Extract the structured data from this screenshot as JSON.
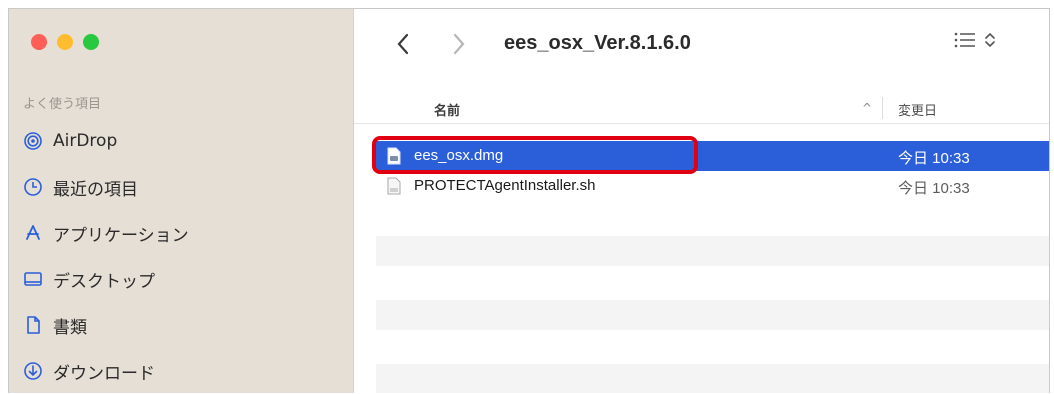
{
  "window": {
    "title": "ees_osx_Ver.8.1.6.0"
  },
  "sidebar": {
    "section_label": "よく使う項目",
    "items": [
      {
        "label": "AirDrop",
        "icon": "airdrop-icon"
      },
      {
        "label": "最近の項目",
        "icon": "clock-icon"
      },
      {
        "label": "アプリケーション",
        "icon": "applications-icon"
      },
      {
        "label": "デスクトップ",
        "icon": "desktop-icon"
      },
      {
        "label": "書類",
        "icon": "document-icon"
      },
      {
        "label": "ダウンロード",
        "icon": "download-icon"
      }
    ]
  },
  "colors": {
    "accent": "#2b5fd9",
    "sidebar_bg": "#e6dfd6",
    "annotation_red": "#e00012"
  },
  "columns": {
    "name": "名前",
    "date_modified": "変更日",
    "sort_indicator": "^"
  },
  "files": [
    {
      "name": "ees_osx.dmg",
      "date": "今日 10:33",
      "selected": true,
      "icon": "disk-image-icon"
    },
    {
      "name": "PROTECTAgentInstaller.sh",
      "date": "今日 10:33",
      "selected": false,
      "icon": "script-file-icon"
    }
  ]
}
